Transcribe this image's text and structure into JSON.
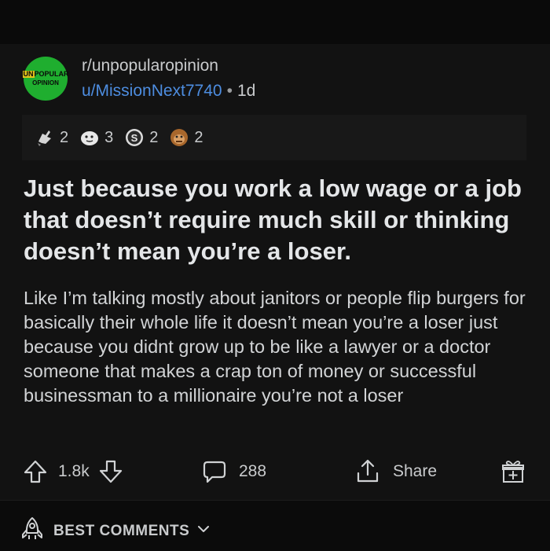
{
  "post": {
    "subreddit": "r/unpopularopinion",
    "username": "u/MissionNext7740",
    "separator": "•",
    "age": "1d",
    "avatar": {
      "line1_a": "UN",
      "line1_b": "POPULAR",
      "line2": "OPINION"
    },
    "awards": [
      {
        "icon": "rocket-like-award-icon",
        "count": "2"
      },
      {
        "icon": "wholesome-seal-award-icon",
        "count": "3"
      },
      {
        "icon": "silver-s-award-icon",
        "count": "2"
      },
      {
        "icon": "ape-award-icon",
        "count": "2"
      }
    ],
    "title": "Just because you work a low wage or a job that doesn’t require much skill or thinking doesn’t mean you’re a loser.",
    "body": "Like I’m talking mostly about janitors or people flip burgers for basically their whole life it doesn’t mean you’re a loser just because you didnt grow up to be like a lawyer or a doctor someone that makes a crap ton of money or successful businessman to a millionaire you’re not a loser",
    "votes": "1.8k",
    "comments": "288",
    "share_label": "Share"
  },
  "comments_section": {
    "sort_label": "BEST COMMENTS"
  },
  "colors": {
    "background": "#0c0c0c",
    "card": "#121212",
    "link": "#4d8de0",
    "avatar": "#1fae2f"
  }
}
